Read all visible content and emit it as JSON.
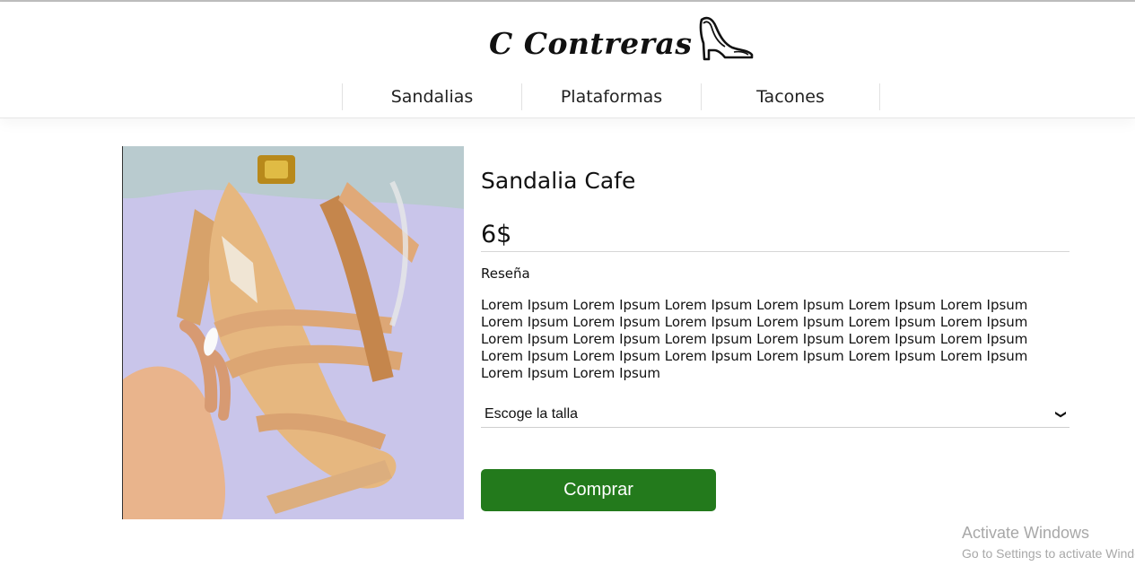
{
  "header": {
    "brand": "C Contreras",
    "logo_icon": "high-heel-shoe-icon",
    "nav": [
      {
        "label": "Sandalias"
      },
      {
        "label": "Plataformas"
      },
      {
        "label": "Tacones"
      }
    ]
  },
  "product": {
    "title": "Sandalia Cafe",
    "price": "6$",
    "review_label": "Reseña",
    "review_text": "Lorem Ipsum Lorem Ipsum Lorem Ipsum Lorem Ipsum Lorem Ipsum Lorem Ipsum Lorem Ipsum Lorem Ipsum Lorem Ipsum Lorem Ipsum Lorem Ipsum Lorem Ipsum Lorem Ipsum Lorem Ipsum Lorem Ipsum Lorem Ipsum Lorem Ipsum Lorem Ipsum Lorem Ipsum Lorem Ipsum Lorem Ipsum Lorem Ipsum Lorem Ipsum Lorem Ipsum Lorem Ipsum Lorem Ipsum",
    "size_select": {
      "selected": "Escoge la talla"
    },
    "buy_label": "Comprar",
    "carousel_next_icon": "chevron-right-icon"
  },
  "colors": {
    "buy_button": "#237a1c",
    "background": "#ffffff"
  },
  "watermark": {
    "line1": "Activate Windows",
    "line2": "Go to Settings to activate Windows."
  }
}
